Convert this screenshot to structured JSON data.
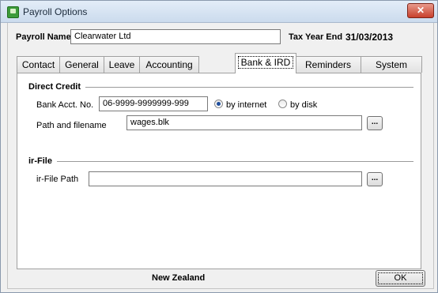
{
  "window": {
    "title": "Payroll Options",
    "close_label": "✕"
  },
  "header": {
    "payroll_name_label": "Payroll Name",
    "payroll_name_value": "Clearwater Ltd",
    "tax_year_end_label": "Tax Year End",
    "tax_year_end_value": "31/03/2013"
  },
  "tabs": [
    {
      "label": "Contact",
      "active": false
    },
    {
      "label": "General",
      "active": false
    },
    {
      "label": "Leave",
      "active": false
    },
    {
      "label": "Accounting",
      "active": false
    },
    {
      "label": "Bank & IRD",
      "active": true
    },
    {
      "label": "Reminders",
      "active": false
    },
    {
      "label": "System",
      "active": false
    }
  ],
  "direct_credit": {
    "title": "Direct Credit",
    "bank_acct_label": "Bank Acct. No.",
    "bank_acct_value": "06-9999-9999999-999",
    "radio_internet_label": "by internet",
    "radio_disk_label": "by disk",
    "selected": "by internet",
    "path_label": "Path and filename",
    "path_value": "wages.blk",
    "browse_label": "..."
  },
  "ir_file": {
    "title": "ir-File",
    "path_label": "ir-File Path",
    "path_value": "",
    "browse_label": "..."
  },
  "footer": {
    "country": "New Zealand",
    "ok_label": "OK"
  }
}
